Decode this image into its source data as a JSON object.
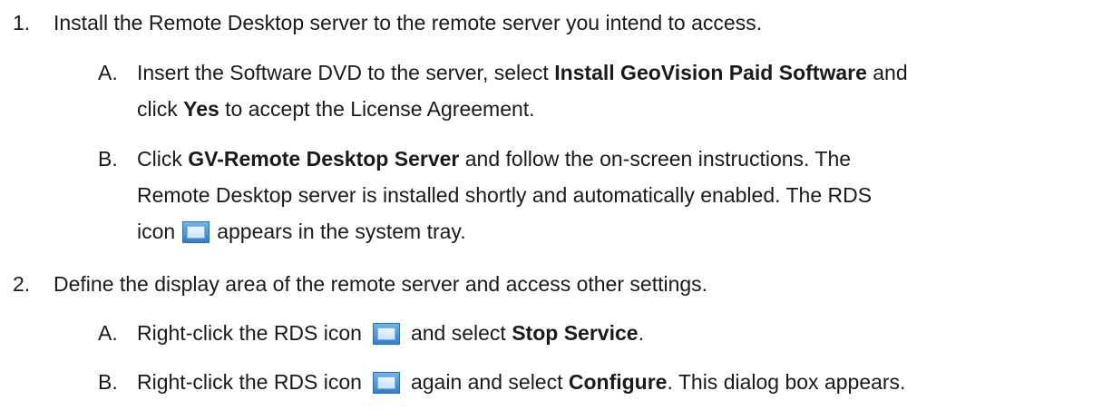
{
  "step1": {
    "number": "1.",
    "text": "Install the Remote Desktop server to the remote server you intend to access.",
    "a": {
      "letter": "A.",
      "t1": "Insert the Software DVD to the server, select ",
      "b1": "Install GeoVision Paid Software",
      "t2": " and",
      "t3": "click ",
      "b2": "Yes",
      "t4": " to accept the License Agreement."
    },
    "b": {
      "letter": "B.",
      "t1": "Click ",
      "b1": "GV-Remote Desktop Server",
      "t2": " and follow the on-screen instructions. The",
      "t3": "Remote Desktop server is installed shortly and automatically enabled. The RDS",
      "t4": "icon",
      "t5": "appears in the system tray."
    }
  },
  "step2": {
    "number": "2.",
    "text": "Define the display area of the remote server and access other settings.",
    "a": {
      "letter": "A.",
      "t1": "Right-click the RDS icon",
      "t2": "and select ",
      "b1": "Stop Service",
      "t3": "."
    },
    "b": {
      "letter": "B.",
      "t1": "Right-click the RDS icon",
      "t2": "again and select ",
      "b1": "Configure",
      "t3": ". This dialog box appears."
    }
  },
  "icons": {
    "rds": "rds-monitor-icon"
  }
}
